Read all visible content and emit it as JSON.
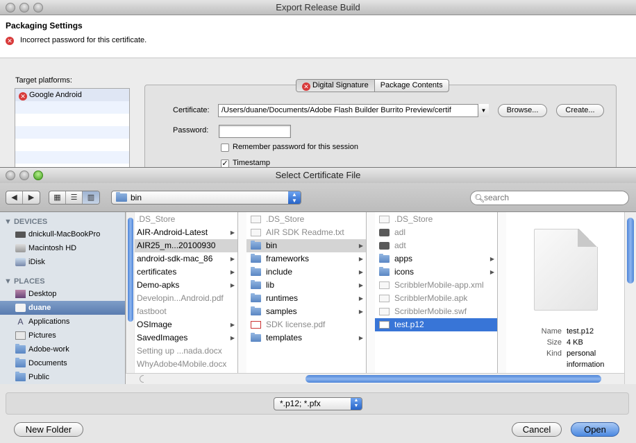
{
  "back_window": {
    "title": "Export Release Build",
    "section_title": "Packaging Settings",
    "error_message": "Incorrect password for this certificate.",
    "target_platforms_label": "Target platforms:",
    "platform": "Google Android",
    "tabs": [
      "Digital Signature",
      "Package Contents"
    ],
    "certificate_label": "Certificate:",
    "certificate_value": "/Users/duane/Documents/Adobe Flash Builder Burrito Preview/certif",
    "browse_button": "Browse...",
    "create_button": "Create...",
    "password_label": "Password:",
    "password_value": "",
    "remember_label": "Remember password for this session",
    "remember_checked": false,
    "timestamp_label": "Timestamp",
    "timestamp_checked": true
  },
  "dialog": {
    "title": "Select Certificate File",
    "path": "bin",
    "search_placeholder": "search",
    "sidebar": {
      "devices_label": "DEVICES",
      "devices": [
        "dnickull-MacBookPro",
        "Macintosh HD",
        "iDisk"
      ],
      "places_label": "PLACES",
      "places": [
        "Desktop",
        "duane",
        "Applications",
        "Pictures",
        "Adobe-work",
        "Documents",
        "Public"
      ],
      "selected": "duane"
    },
    "column1": [
      {
        "name": ".DS_Store",
        "dim": true
      },
      {
        "name": "AIR-Android-Latest",
        "dim": false
      },
      {
        "name": "AIR25_m...20100930",
        "dim": false
      },
      {
        "name": "android-sdk-mac_86",
        "dim": false
      },
      {
        "name": "certificates",
        "dim": false
      },
      {
        "name": "Demo-apks",
        "dim": false
      },
      {
        "name": "Developin...Android.pdf",
        "dim": true
      },
      {
        "name": "fastboot",
        "dim": true
      },
      {
        "name": "OSImage",
        "dim": false
      },
      {
        "name": "SavedImages",
        "dim": false
      },
      {
        "name": "Setting up ...nada.docx",
        "dim": true
      },
      {
        "name": "WhyAdobe4Mobile.docx",
        "dim": true
      }
    ],
    "column2": [
      {
        "name": ".DS_Store",
        "dim": true
      },
      {
        "name": "AIR SDK Readme.txt",
        "dim": true
      },
      {
        "name": "bin",
        "dim": false
      },
      {
        "name": "frameworks",
        "dim": false
      },
      {
        "name": "include",
        "dim": false
      },
      {
        "name": "lib",
        "dim": false
      },
      {
        "name": "runtimes",
        "dim": false
      },
      {
        "name": "samples",
        "dim": false
      },
      {
        "name": "SDK license.pdf",
        "dim": true
      },
      {
        "name": "templates",
        "dim": false
      }
    ],
    "column3": [
      {
        "name": ".DS_Store",
        "dim": true
      },
      {
        "name": "adl",
        "dim": true
      },
      {
        "name": "adt",
        "dim": true
      },
      {
        "name": "apps",
        "dim": false
      },
      {
        "name": "icons",
        "dim": false
      },
      {
        "name": "ScribblerMobile-app.xml",
        "dim": true
      },
      {
        "name": "ScribblerMobile.apk",
        "dim": true
      },
      {
        "name": "ScribblerMobile.swf",
        "dim": true
      },
      {
        "name": "test.p12",
        "dim": false
      }
    ],
    "preview": {
      "name_label": "Name",
      "name": "test.p12",
      "size_label": "Size",
      "size": "4 KB",
      "kind_label": "Kind",
      "kind_line1": "personal",
      "kind_line2": "information"
    },
    "file_filter": "*.p12; *.pfx",
    "new_folder_button": "New Folder",
    "cancel_button": "Cancel",
    "open_button": "Open"
  }
}
